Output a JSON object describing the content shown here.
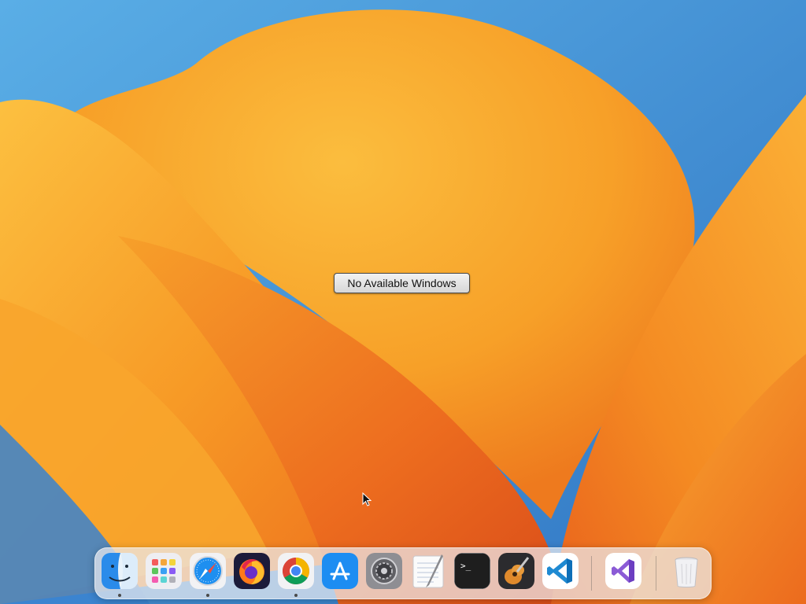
{
  "desktop": {
    "wallpaper_name": "macos-ventura-wallpaper",
    "colors": {
      "sky": "#3d8fd6",
      "petal_light": "#fbb538",
      "petal_mid": "#f59a25",
      "petal_deep": "#e2561c"
    }
  },
  "overlay": {
    "no_windows_label": "No Available Windows"
  },
  "dock": {
    "items": [
      {
        "name": "finder",
        "icon": "finder-icon",
        "running": true
      },
      {
        "name": "launchpad",
        "icon": "launchpad-icon",
        "running": false
      },
      {
        "name": "safari",
        "icon": "safari-icon",
        "running": true
      },
      {
        "name": "firefox",
        "icon": "firefox-icon",
        "running": false
      },
      {
        "name": "chrome",
        "icon": "chrome-icon",
        "running": true
      },
      {
        "name": "app-store",
        "icon": "app-store-icon",
        "running": false
      },
      {
        "name": "system-settings",
        "icon": "gear-icon",
        "running": false
      },
      {
        "name": "textedit",
        "icon": "textedit-icon",
        "running": false
      },
      {
        "name": "terminal",
        "icon": "terminal-icon",
        "running": false
      },
      {
        "name": "garageband",
        "icon": "guitar-icon",
        "running": false
      },
      {
        "name": "vscode",
        "icon": "vscode-icon",
        "running": false
      },
      {
        "name": "visual-studio",
        "icon": "visual-studio-icon",
        "running": false
      },
      {
        "name": "trash",
        "icon": "trash-icon",
        "running": false
      }
    ],
    "terminal_prompt": ">_"
  }
}
